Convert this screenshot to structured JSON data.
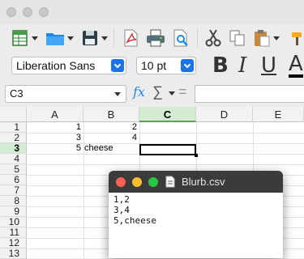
{
  "window": {
    "traffic_lights": [
      "close",
      "minimize",
      "zoom"
    ]
  },
  "toolbar": {
    "buttons": [
      {
        "name": "new-spreadsheet",
        "icon": "spreadsheet-new-icon",
        "has_dropdown": true
      },
      {
        "name": "open",
        "icon": "folder-icon",
        "has_dropdown": true
      },
      {
        "name": "save",
        "icon": "floppy-disk-icon",
        "has_dropdown": true
      },
      {
        "name": "export-pdf",
        "icon": "pdf-icon"
      },
      {
        "name": "print",
        "icon": "printer-icon"
      },
      {
        "name": "print-preview",
        "icon": "print-preview-icon"
      },
      {
        "name": "cut",
        "icon": "scissors-icon"
      },
      {
        "name": "copy",
        "icon": "copy-icon"
      },
      {
        "name": "paste",
        "icon": "clipboard-icon",
        "has_dropdown": true
      }
    ]
  },
  "format": {
    "font_name": "Liberation Sans",
    "font_size": "10 pt",
    "bold": "B",
    "italic": "I",
    "underline": "U",
    "font_color": "A"
  },
  "formula": {
    "cell_ref": "C3",
    "fx": "fx",
    "sigma": "∑",
    "equals": "="
  },
  "sheet": {
    "columns": [
      "A",
      "B",
      "C",
      "D",
      "E"
    ],
    "active_column": "C",
    "rows": [
      "1",
      "2",
      "3",
      "4",
      "5",
      "6",
      "7",
      "8",
      "9",
      "10",
      "11",
      "12",
      "13"
    ],
    "active_row": "3",
    "cells": {
      "A1": "1",
      "B1": "2",
      "A2": "3",
      "B2": "4",
      "A3": "5",
      "B3": "cheese"
    },
    "accent_color": "#d3ebd1"
  },
  "blurb_window": {
    "title": "Blurb.csv",
    "file_icon": "document-icon",
    "lines": [
      "1,2",
      "3,4",
      "5,cheese"
    ],
    "traffic_light_colors": [
      "#ff5f57",
      "#febc2e",
      "#28c840"
    ]
  }
}
